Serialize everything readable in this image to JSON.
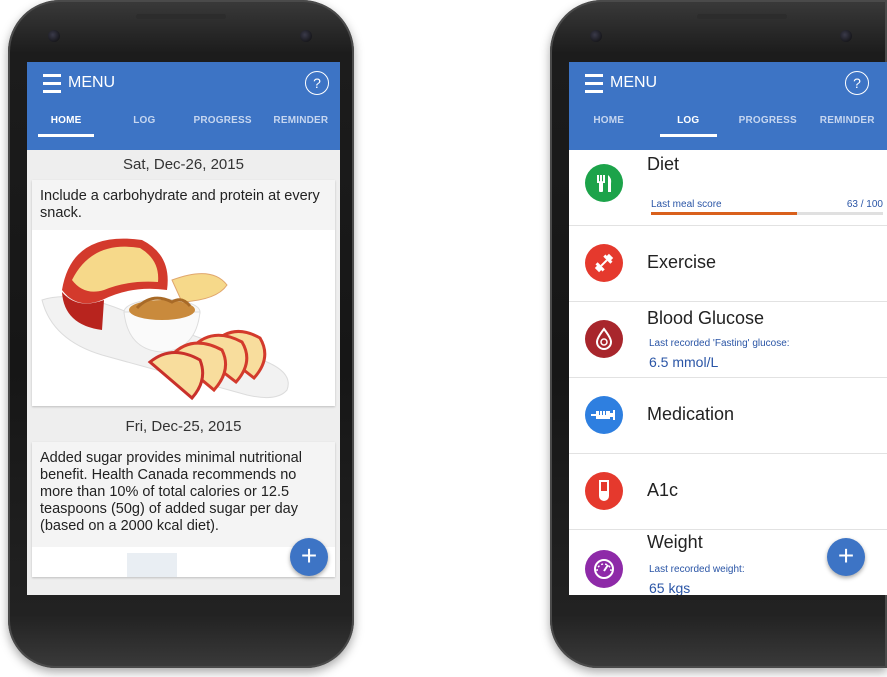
{
  "left_phone": {
    "menu_label": "MENU",
    "help_label": "?",
    "tabs": [
      {
        "label": "HOME",
        "active": true
      },
      {
        "label": "LOG",
        "active": false
      },
      {
        "label": "PROGRESS",
        "active": false
      },
      {
        "label": "REMINDER",
        "active": false
      }
    ],
    "feed": [
      {
        "date": "Sat, Dec-26, 2015",
        "tip": "Include a carbohydrate and protein at every snack.",
        "image": "apple-slices-peanut-butter"
      },
      {
        "date": "Fri, Dec-25, 2015",
        "tip": "Added sugar provides minimal nutritional benefit. Health Canada recommends no more than 10% of total calories or 12.5 teaspoons (50g) of added sugar per day (based on a 2000 kcal diet)."
      }
    ],
    "fab_label": "+"
  },
  "right_phone": {
    "menu_label": "MENU",
    "help_label": "?",
    "tabs": [
      {
        "label": "HOME",
        "active": false
      },
      {
        "label": "LOG",
        "active": true
      },
      {
        "label": "PROGRESS",
        "active": false
      },
      {
        "label": "REMINDER",
        "active": false
      }
    ],
    "log": {
      "diet": {
        "title": "Diet",
        "score_label": "Last meal score",
        "score_value": "63 / 100",
        "score_fraction": 0.63,
        "icon": "fork-knife-icon",
        "color": "#1ca34a"
      },
      "exercise": {
        "title": "Exercise",
        "icon": "dumbbell-icon",
        "color": "#e5392d"
      },
      "glucose": {
        "title": "Blood Glucose",
        "sub": "Last recorded 'Fasting' glucose:",
        "value": "6.5 mmol/L",
        "icon": "blood-drop-icon",
        "color": "#a8262c"
      },
      "medication": {
        "title": "Medication",
        "icon": "syringe-icon",
        "color": "#2e7fe0"
      },
      "a1c": {
        "title": "A1c",
        "icon": "test-tube-icon",
        "color": "#e5392d"
      },
      "weight": {
        "title": "Weight",
        "sub": "Last recorded weight:",
        "value": "65 kgs",
        "icon": "scale-gauge-icon",
        "color": "#8e2aa8"
      }
    },
    "fab_label": "+"
  }
}
